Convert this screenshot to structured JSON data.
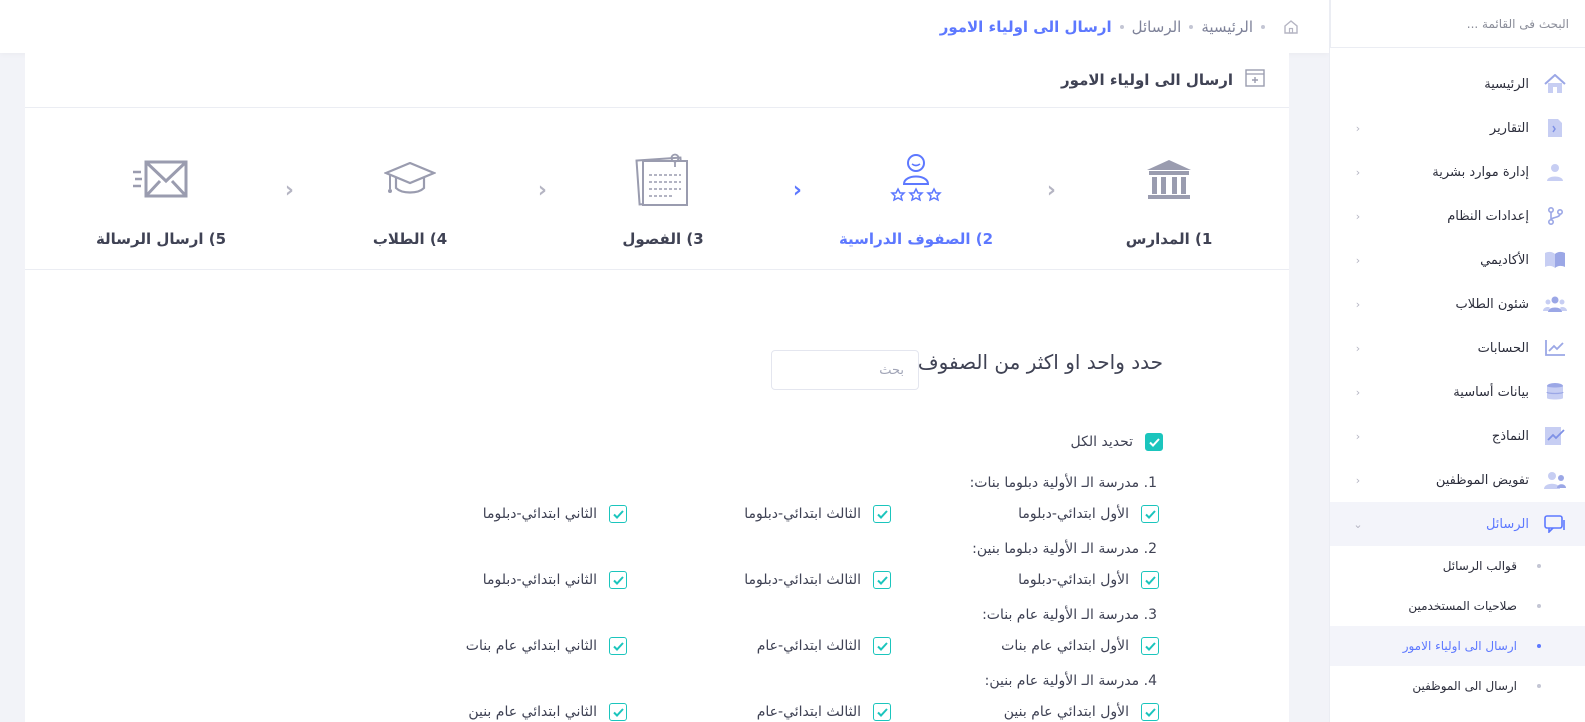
{
  "topbar": {
    "breadcrumb": [
      "الرئيسية",
      "الرسائل",
      "ارسال الى اولياء الامور"
    ]
  },
  "sidebar": {
    "search_placeholder": "البحث فى القائمة ...",
    "items": [
      {
        "label": "الرئيسية",
        "icon": "home-icon"
      },
      {
        "label": "التقارير",
        "icon": "report-icon"
      },
      {
        "label": "إدارة موارد بشرية",
        "icon": "user-icon"
      },
      {
        "label": "إعدادات النظام",
        "icon": "git-icon"
      },
      {
        "label": "الأكاديمي",
        "icon": "book-icon"
      },
      {
        "label": "شئون الطلاب",
        "icon": "group-icon"
      },
      {
        "label": "الحسابات",
        "icon": "chart-icon"
      },
      {
        "label": "بيانات أساسية",
        "icon": "database-icon"
      },
      {
        "label": "النماذج",
        "icon": "forms-icon"
      },
      {
        "label": "تفويض الموظفين",
        "icon": "users-icon"
      },
      {
        "label": "الرسائل",
        "icon": "messages-icon"
      }
    ],
    "sub_items": [
      {
        "label": "قوالب الرسائل"
      },
      {
        "label": "صلاحيات المستخدمين"
      },
      {
        "label": "ارسال الى اولياء الامور"
      },
      {
        "label": "ارسال الى الموظفين"
      }
    ]
  },
  "card": {
    "title": "ارسال الى اولياء الامور"
  },
  "steps": [
    {
      "label": "1) المدارس"
    },
    {
      "label": "2) الصفوف الدراسية"
    },
    {
      "label": "3) الفصول"
    },
    {
      "label": "4) الطلاب"
    },
    {
      "label": "5) ارسال الرسالة"
    }
  ],
  "form": {
    "title": "حدد واحد او اكثر من الصفوف",
    "search_placeholder": "بحث",
    "select_all": "تحديد الكل",
    "schools": [
      {
        "title": "1. مدرسة الـ الأولية دبلوما بنات:",
        "grades": [
          "الأول ابتدائي-دبلوما",
          "الثالث ابتدائي-دبلوما",
          "الثاني ابتدائي-دبلوما"
        ]
      },
      {
        "title": "2. مدرسة الـ الأولية دبلوما بنين:",
        "grades": [
          "الأول ابتدائي-دبلوما",
          "الثالث ابتدائي-دبلوما",
          "الثاني ابتدائي-دبلوما"
        ]
      },
      {
        "title": "3. مدرسة الـ الأولية عام بنات:",
        "grades": [
          "الأول ابتدائي عام بنات",
          "الثالث ابتدائي-عام",
          "الثاني ابتدائي عام بنات"
        ]
      },
      {
        "title": "4. مدرسة الـ الأولية عام بنين:",
        "grades": [
          "الأول ابتدائي عام بنين",
          "الثالث ابتدائي-عام",
          "الثاني ابتدائي عام بنين"
        ]
      }
    ]
  },
  "colors": {
    "accent": "#5d78ff",
    "check": "#1bc5bd",
    "icon_gray": "#9a9caf"
  }
}
